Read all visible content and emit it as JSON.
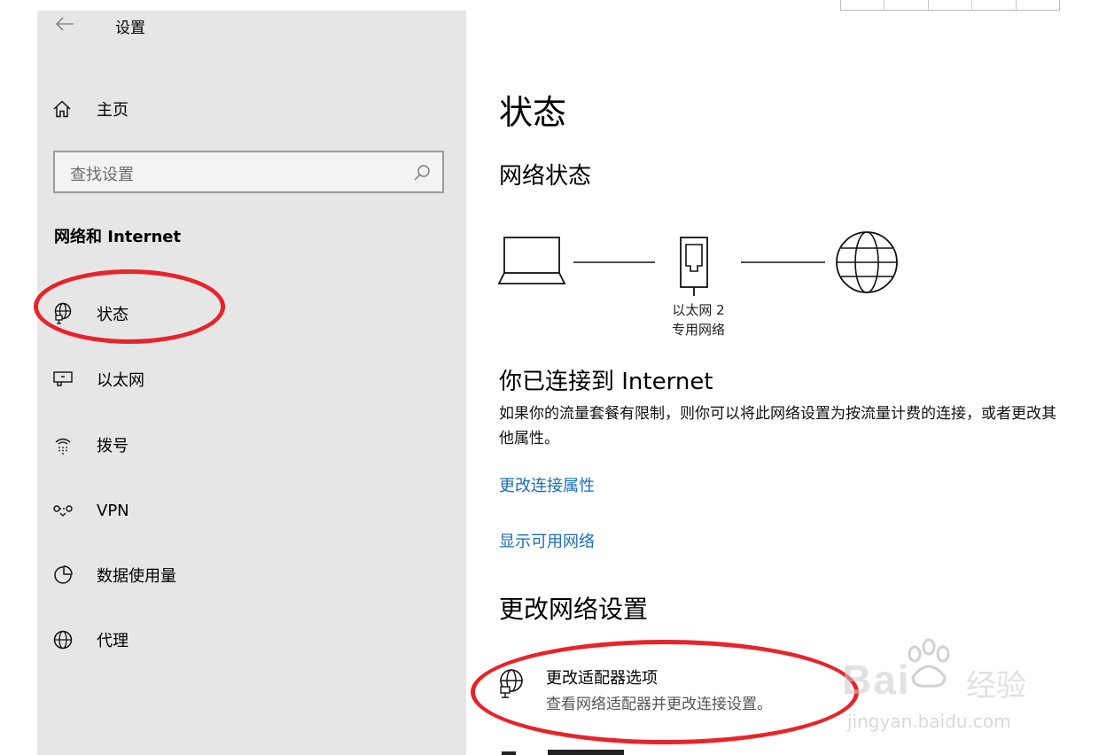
{
  "app": {
    "title": "设置"
  },
  "sidebar": {
    "home_label": "主页",
    "search_placeholder": "查找设置",
    "section_heading": "网络和 Internet",
    "items": [
      {
        "label": "状态",
        "icon": "status-globe-icon",
        "selected": true
      },
      {
        "label": "以太网",
        "icon": "ethernet-icon"
      },
      {
        "label": "拨号",
        "icon": "dialup-icon"
      },
      {
        "label": "VPN",
        "icon": "vpn-icon"
      },
      {
        "label": "数据使用量",
        "icon": "data-usage-icon"
      },
      {
        "label": "代理",
        "icon": "globe-icon"
      }
    ]
  },
  "main": {
    "title": "状态",
    "network_status_heading": "网络状态",
    "diagram": {
      "adapter_name": "以太网 2",
      "network_type": "专用网络"
    },
    "connected_heading": "你已连接到 Internet",
    "description": "如果你的流量套餐有限制，则你可以将此网络设置为按流量计费的连接，或者更改其他属性。",
    "links": {
      "change_connection_properties": "更改连接属性",
      "show_available_networks": "显示可用网络"
    },
    "change_settings_heading": "更改网络设置",
    "adapter_options": {
      "title": "更改适配器选项",
      "subtitle": "查看网络适配器并更改连接设置。"
    }
  },
  "watermark": {
    "brand": "Bai",
    "product": "经验",
    "url": "jingyan.baidu.com"
  },
  "colors": {
    "sidebar_bg": "#e6e6e6",
    "link": "#1a6fb3",
    "annotation_ring": "#e8232a"
  }
}
